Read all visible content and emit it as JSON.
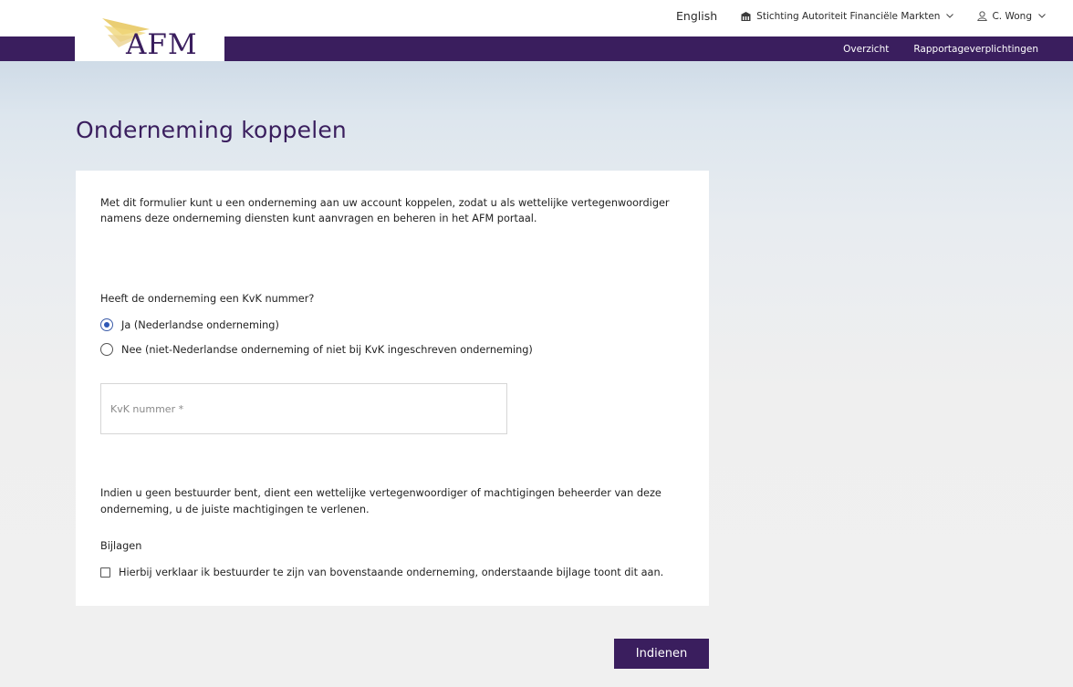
{
  "header": {
    "logo_text": "AFM",
    "language": "English",
    "organization": "Stichting Autoriteit Financiële Markten",
    "user": "C. Wong",
    "nav": [
      "Overzicht",
      "Rapportageverplichtingen"
    ],
    "brand_color": "#3a1e5e"
  },
  "page": {
    "title": "Onderneming koppelen"
  },
  "form": {
    "intro": "Met dit formulier kunt u een onderneming aan uw account koppelen, zodat u als wettelijke vertegenwoordiger namens deze onderneming diensten kunt aanvragen en beheren in het AFM portaal.",
    "question": "Heeft de onderneming een KvK nummer?",
    "options": [
      {
        "label": "Ja (Nederlandse onderneming)",
        "selected": true
      },
      {
        "label": "Nee (niet-Nederlandse onderneming of niet bij KvK ingeschreven onderneming)",
        "selected": false
      }
    ],
    "kvk_placeholder": "KvK nummer *",
    "kvk_value": "",
    "notice": "Indien u geen bestuurder bent, dient een wettelijke vertegenwoordiger of machtigingen beheerder van deze onderneming, u de juiste machtigingen te verlenen.",
    "attachments_label": "Bijlagen",
    "declaration": "Hierbij verklaar ik bestuurder te zijn van bovenstaande onderneming, onderstaande bijlage toont dit aan.",
    "declaration_checked": false,
    "submit_label": "Indienen"
  }
}
